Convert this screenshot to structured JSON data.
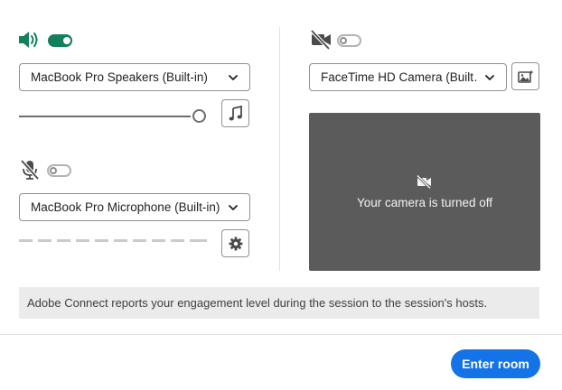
{
  "audio": {
    "speaker_icon": "speaker-volume-icon",
    "speaker_enabled": true,
    "speaker_device": "MacBook Pro Speakers (Built-in)",
    "speaker_volume": 1.0,
    "test_sound_icon": "music-note-icon",
    "mic_icon": "microphone-muted-icon",
    "mic_enabled": false,
    "mic_device": "MacBook Pro Microphone (Built-in)",
    "mic_settings_icon": "gear-icon"
  },
  "video": {
    "camera_icon": "camera-off-icon",
    "camera_enabled": false,
    "camera_device": "FaceTime HD Camera (Built…",
    "background_icon": "background-effects-icon",
    "preview_message": "Your camera is turned off"
  },
  "notice": {
    "text": "Adobe Connect reports your engagement level during the session to the session's hosts."
  },
  "footer": {
    "enter_label": "Enter room"
  },
  "colors": {
    "accent_green": "#12805c",
    "primary_blue": "#1473e6",
    "preview_bg": "#5b5b5b"
  }
}
